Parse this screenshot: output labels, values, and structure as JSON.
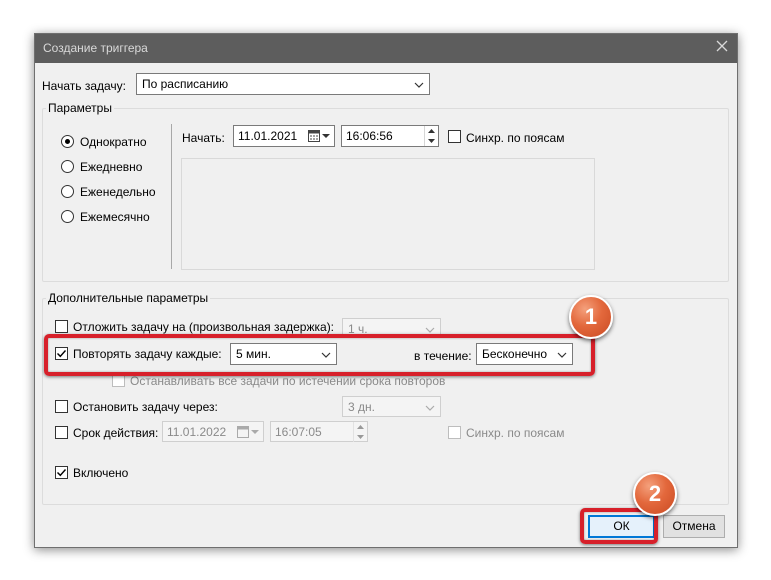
{
  "dialog": {
    "title": "Создание триггера",
    "close_icon": "close-icon"
  },
  "begin_task": {
    "label": "Начать задачу:",
    "value": "По расписанию"
  },
  "parameters": {
    "group_title": "Параметры",
    "radios": [
      {
        "label": "Однократно",
        "selected": true
      },
      {
        "label": "Ежедневно",
        "selected": false
      },
      {
        "label": "Еженедельно",
        "selected": false
      },
      {
        "label": "Ежемесячно",
        "selected": false
      }
    ],
    "start_label": "Начать:",
    "start_date": "11.01.2021",
    "start_time": "16:06:56",
    "sync_timezones_label": "Синхр. по поясам",
    "sync_timezones_checked": false
  },
  "advanced": {
    "group_title": "Дополнительные параметры",
    "delay_label": "Отложить задачу на (произвольная задержка):",
    "delay_value": "1 ч.",
    "delay_checked": false,
    "repeat_label": "Повторять задачу каждые:",
    "repeat_checked": true,
    "repeat_value": "5 мин.",
    "duration_label": "в течение:",
    "duration_value": "Бесконечно",
    "stop_all_label": "Останавливать все задачи по истечении срока повторов",
    "stop_all_checked": false,
    "stop_after_label": "Остановить задачу через:",
    "stop_after_checked": false,
    "stop_after_value": "3 дн.",
    "expire_label": "Срок действия:",
    "expire_checked": false,
    "expire_date": "11.01.2022",
    "expire_time": "16:07:05",
    "expire_sync_label": "Синхр. по поясам",
    "expire_sync_checked": false,
    "enabled_label": "Включено",
    "enabled_checked": true
  },
  "buttons": {
    "ok": "ОК",
    "cancel": "Отмена"
  },
  "annotations": {
    "badge1": "1",
    "badge2": "2",
    "color": "#d7202a"
  }
}
